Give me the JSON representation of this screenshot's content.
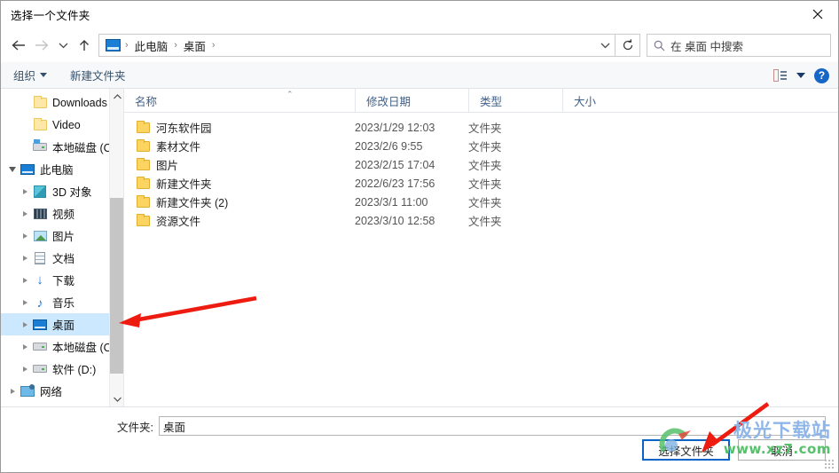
{
  "window": {
    "title": "选择一个文件夹",
    "close_icon": "close-icon"
  },
  "nav": {
    "back_icon": "back-arrow-icon",
    "forward_icon": "forward-arrow-icon",
    "recent_icon": "chevron-down-icon",
    "up_icon": "up-arrow-icon",
    "refresh_icon": "refresh-icon",
    "breadcrumb": [
      {
        "label": "此电脑",
        "icon": "this-pc-icon"
      },
      {
        "label": "桌面",
        "icon": ""
      }
    ],
    "separator": "›"
  },
  "search": {
    "placeholder": "在 桌面 中搜索",
    "icon": "search-icon"
  },
  "toolbar": {
    "organize_label": "组织",
    "new_folder_label": "新建文件夹",
    "view_icon": "view-options-icon",
    "view_caret": "▾",
    "help_label": "?"
  },
  "sidebar": {
    "items": [
      {
        "label": "Downloads",
        "icon": "folder-icon",
        "indent": 2,
        "twisty": "none",
        "selected": false
      },
      {
        "label": "Video",
        "icon": "folder-icon",
        "indent": 2,
        "twisty": "none",
        "selected": false
      },
      {
        "label": "本地磁盘 (C:)",
        "icon": "drive-pinned-icon",
        "indent": 2,
        "twisty": "none",
        "selected": false
      },
      {
        "label": "此电脑",
        "icon": "this-pc-icon",
        "indent": 1,
        "twisty": "open",
        "selected": false
      },
      {
        "label": "3D 对象",
        "icon": "3d-objects-icon",
        "indent": 2,
        "twisty": "closed",
        "selected": false
      },
      {
        "label": "视频",
        "icon": "videos-icon",
        "indent": 2,
        "twisty": "closed",
        "selected": false
      },
      {
        "label": "图片",
        "icon": "pictures-icon",
        "indent": 2,
        "twisty": "closed",
        "selected": false
      },
      {
        "label": "文档",
        "icon": "documents-icon",
        "indent": 2,
        "twisty": "closed",
        "selected": false
      },
      {
        "label": "下载",
        "icon": "downloads-icon",
        "indent": 2,
        "twisty": "closed",
        "selected": false
      },
      {
        "label": "音乐",
        "icon": "music-icon",
        "indent": 2,
        "twisty": "closed",
        "selected": false
      },
      {
        "label": "桌面",
        "icon": "desktop-icon",
        "indent": 2,
        "twisty": "closed",
        "selected": true
      },
      {
        "label": "本地磁盘 (C:)",
        "icon": "drive-icon",
        "indent": 2,
        "twisty": "closed",
        "selected": false
      },
      {
        "label": "软件 (D:)",
        "icon": "drive-icon",
        "indent": 2,
        "twisty": "closed",
        "selected": false
      },
      {
        "label": "网络",
        "icon": "network-icon",
        "indent": 1,
        "twisty": "closed",
        "selected": false
      }
    ],
    "scroll_up_icon": "scroll-up-icon",
    "scroll_down_icon": "scroll-down-icon"
  },
  "filelist": {
    "columns": [
      "名称",
      "修改日期",
      "类型",
      "大小"
    ],
    "sort_caret": "⌃",
    "rows": [
      {
        "name": "河东软件园",
        "date": "2023/1/29 12:03",
        "type": "文件夹",
        "size": ""
      },
      {
        "name": "素材文件",
        "date": "2023/2/6 9:55",
        "type": "文件夹",
        "size": ""
      },
      {
        "name": "图片",
        "date": "2023/2/15 17:04",
        "type": "文件夹",
        "size": ""
      },
      {
        "name": "新建文件夹",
        "date": "2022/6/23 17:56",
        "type": "文件夹",
        "size": ""
      },
      {
        "name": "新建文件夹 (2)",
        "date": "2023/3/1 11:00",
        "type": "文件夹",
        "size": ""
      },
      {
        "name": "资源文件",
        "date": "2023/3/10 12:58",
        "type": "文件夹",
        "size": ""
      }
    ]
  },
  "footer": {
    "folder_label": "文件夹:",
    "folder_value": "桌面",
    "folder_placeholder": "",
    "select_button": "选择文件夹",
    "cancel_button": "取消"
  },
  "watermark": {
    "main": "极光下载站",
    "sub": "www.xz7.com"
  },
  "annotations": {
    "arrow_sidebar": "red-arrow-icon",
    "arrow_button": "red-arrow-icon",
    "color": "#ee1b10"
  }
}
